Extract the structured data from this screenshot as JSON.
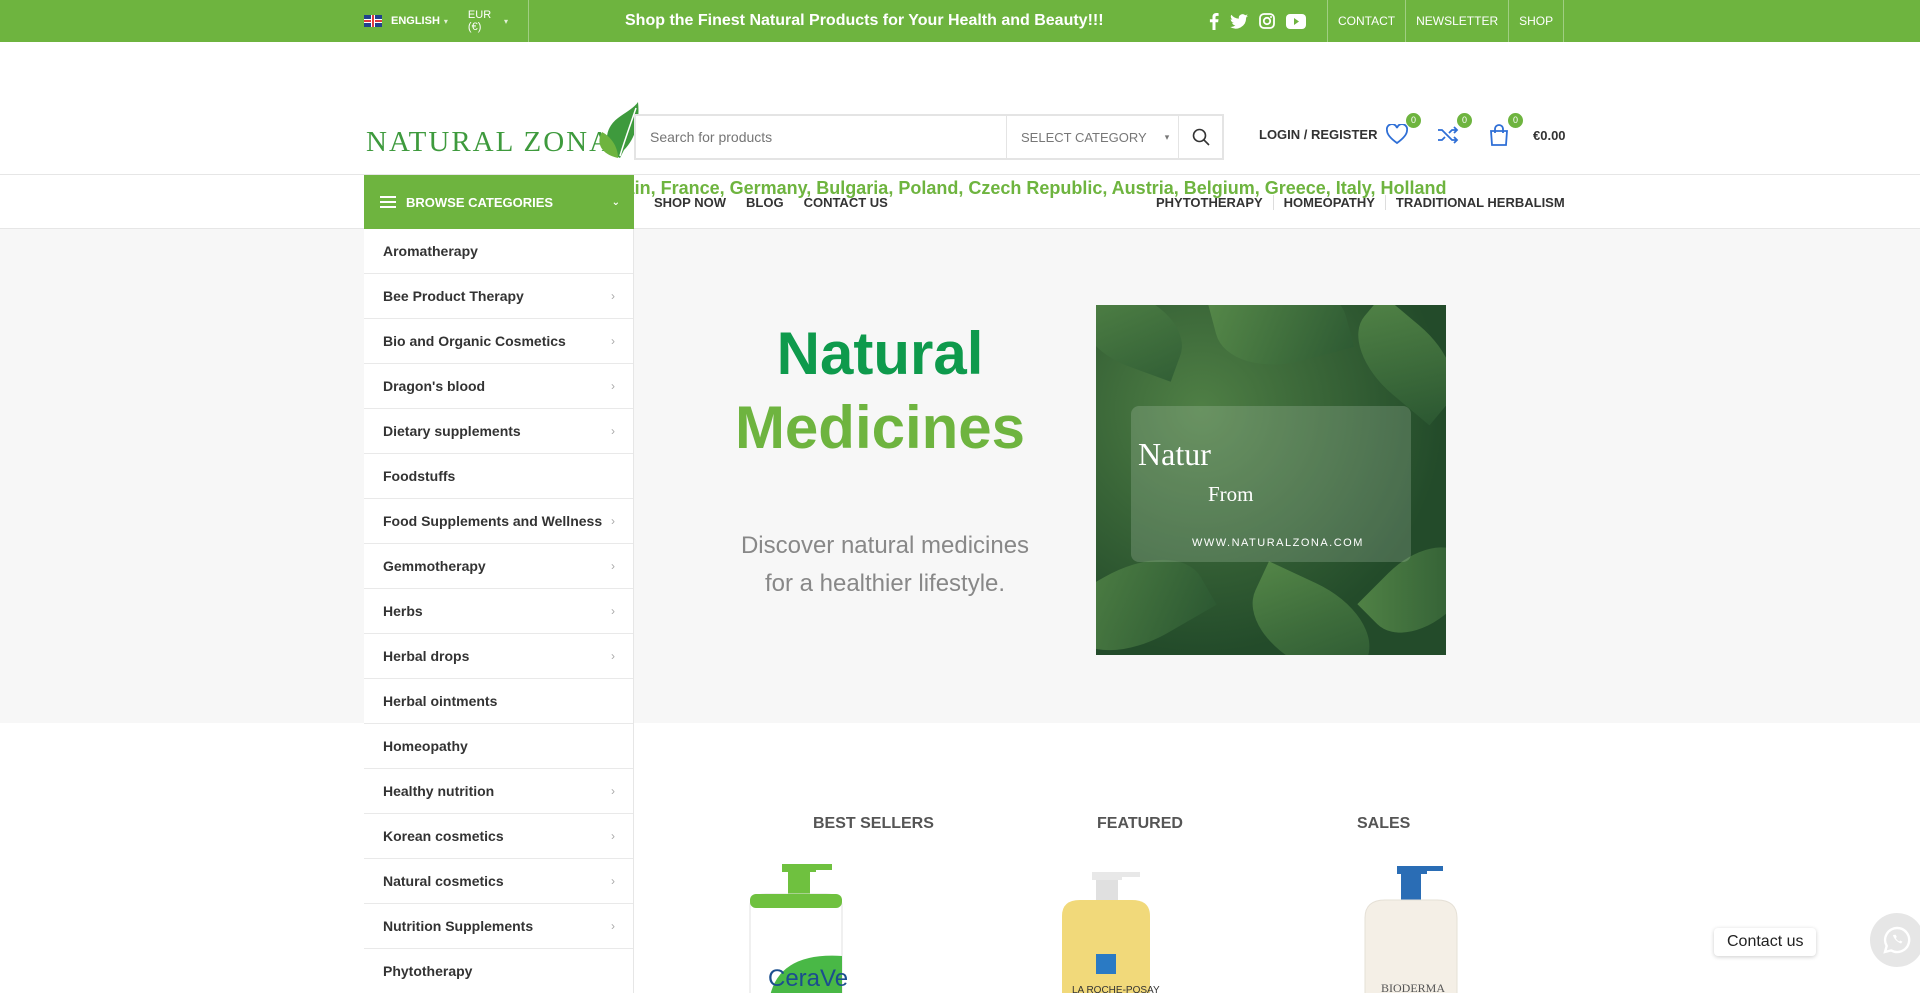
{
  "topbar": {
    "language": "ENGLISH",
    "currency": "EUR (€)",
    "message": "Shop the Finest Natural Products for Your Health and Beauty!!!",
    "social": [
      "facebook-icon",
      "twitter-icon",
      "instagram-icon",
      "youtube-icon"
    ],
    "links": [
      "CONTACT",
      "NEWSLETTER",
      "SHOP"
    ]
  },
  "header": {
    "logo_text": "NATURAL ZONA",
    "search_placeholder": "Search for products",
    "category_select": "SELECT CATEGORY",
    "login": "LOGIN / REGISTER",
    "wishlist_count": "0",
    "compare_count": "0",
    "cart_count": "0",
    "cart_total": "€0.00",
    "countries": " Products from Spain, France, Germany, Bulgaria, Poland, Czech Republic, Austria, Belgium, Greece, Italy, Holland "
  },
  "nav": {
    "browse": "BROWSE CATEGORIES",
    "main": [
      "SHOP NOW",
      "BLOG",
      "CONTACT US"
    ],
    "right": [
      "PHYTOTHERAPY",
      "HOMEOPATHY",
      "TRADITIONAL HERBALISM"
    ]
  },
  "categories": [
    {
      "label": "Aromatherapy",
      "arrow": false
    },
    {
      "label": "Bee Product Therapy",
      "arrow": true
    },
    {
      "label": "Bio and Organic Cosmetics",
      "arrow": true
    },
    {
      "label": "Dragon's blood",
      "arrow": true
    },
    {
      "label": "Dietary supplements",
      "arrow": true
    },
    {
      "label": "Foodstuffs",
      "arrow": false
    },
    {
      "label": "Food Supplements and Wellness",
      "arrow": true
    },
    {
      "label": "Gemmotherapy",
      "arrow": true
    },
    {
      "label": "Herbs",
      "arrow": true
    },
    {
      "label": "Herbal drops",
      "arrow": true
    },
    {
      "label": "Herbal ointments",
      "arrow": false
    },
    {
      "label": "Homeopathy",
      "arrow": false
    },
    {
      "label": "Healthy nutrition",
      "arrow": true
    },
    {
      "label": "Korean cosmetics",
      "arrow": true
    },
    {
      "label": "Natural cosmetics",
      "arrow": true
    },
    {
      "label": "Nutrition Supplements",
      "arrow": true
    },
    {
      "label": "Phytotherapy",
      "arrow": false
    }
  ],
  "hero": {
    "title_line1": "Natural",
    "title_line2": "Medicines",
    "subtitle_line1": "Discover natural medicines",
    "subtitle_line2": "for a healthier lifestyle.",
    "image_word1": "Natur",
    "image_word2": "From",
    "image_url_text": "WWW.NATURALZONA.COM"
  },
  "product_tabs": [
    "BEST SELLERS",
    "FEATURED",
    "SALES"
  ],
  "products": [
    {
      "brand": "CeraVe"
    },
    {
      "brand": "LA ROCHE-POSAY"
    },
    {
      "brand": "BIODERMA"
    }
  ],
  "contact_label": "Contact us",
  "colors": {
    "brand_green": "#6eb43f",
    "dark_green": "#0e9a4c"
  }
}
